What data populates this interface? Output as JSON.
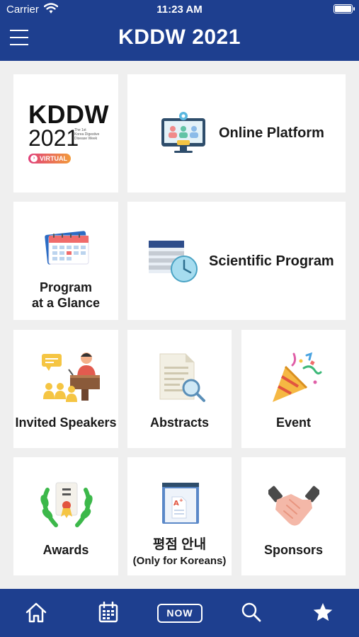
{
  "status_bar": {
    "carrier": "Carrier",
    "time": "11:23 AM"
  },
  "header": {
    "title": "KDDW 2021"
  },
  "logo": {
    "line1": "KDDW",
    "line2": "2021",
    "subtitle_1": "The 1st",
    "subtitle_2": "Korea Digestive",
    "subtitle_3": "Disease Week",
    "badge": "VIRTUAL"
  },
  "tiles": {
    "online_platform": "Online Platform",
    "scientific_program": "Scientific Program",
    "program_glance_1": "Program",
    "program_glance_2": "at a Glance",
    "invited_speakers": "Invited Speakers",
    "abstracts": "Abstracts",
    "event": "Event",
    "awards": "Awards",
    "rating_1": "평점 안내",
    "rating_2": "(Only for Koreans)",
    "sponsors": "Sponsors"
  },
  "nav": {
    "now": "NOW"
  },
  "colors": {
    "primary": "#1e3f8f",
    "background": "#efefef",
    "tile": "#ffffff",
    "badge": "#e0407a"
  }
}
